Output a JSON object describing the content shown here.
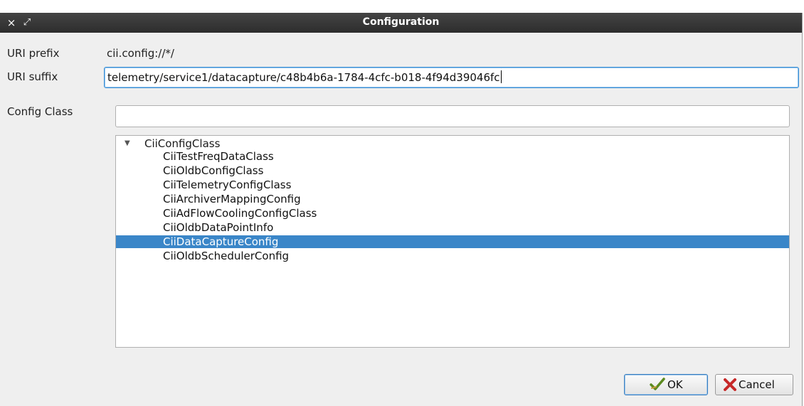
{
  "window": {
    "title": "Configuration",
    "close_glyph": "×",
    "maximize_glyph": "⤢"
  },
  "form": {
    "uri_prefix_label": "URI prefix",
    "uri_prefix_value": "cii.config://*/",
    "uri_suffix_label": "URI suffix",
    "uri_suffix_value": "telemetry/service1/datacapture/c48b4b6a-1784-4cfc-b018-4f94d39046fc",
    "config_class_label": "Config Class",
    "config_class_filter_value": ""
  },
  "tree": {
    "root": {
      "label": "CiiConfigClass",
      "expanded": true
    },
    "children": [
      {
        "label": "CiiTestFreqDataClass",
        "selected": false
      },
      {
        "label": "CiiOldbConfigClass",
        "selected": false
      },
      {
        "label": "CiiTelemetryConfigClass",
        "selected": false
      },
      {
        "label": "CiiArchiverMappingConfig",
        "selected": false
      },
      {
        "label": "CiiAdFlowCoolingConfigClass",
        "selected": false
      },
      {
        "label": "CiiOldbDataPointInfo",
        "selected": false
      },
      {
        "label": "CiiDataCaptureConfig",
        "selected": true
      },
      {
        "label": "CiiOldbSchedulerConfig",
        "selected": false
      }
    ]
  },
  "buttons": {
    "ok_label": "OK",
    "ok_icon": "check-icon",
    "cancel_label": "Cancel",
    "cancel_icon": "x-icon"
  },
  "colors": {
    "selection": "#3a86c8",
    "titlebar": "#333333",
    "focus": "#3c90d6"
  }
}
